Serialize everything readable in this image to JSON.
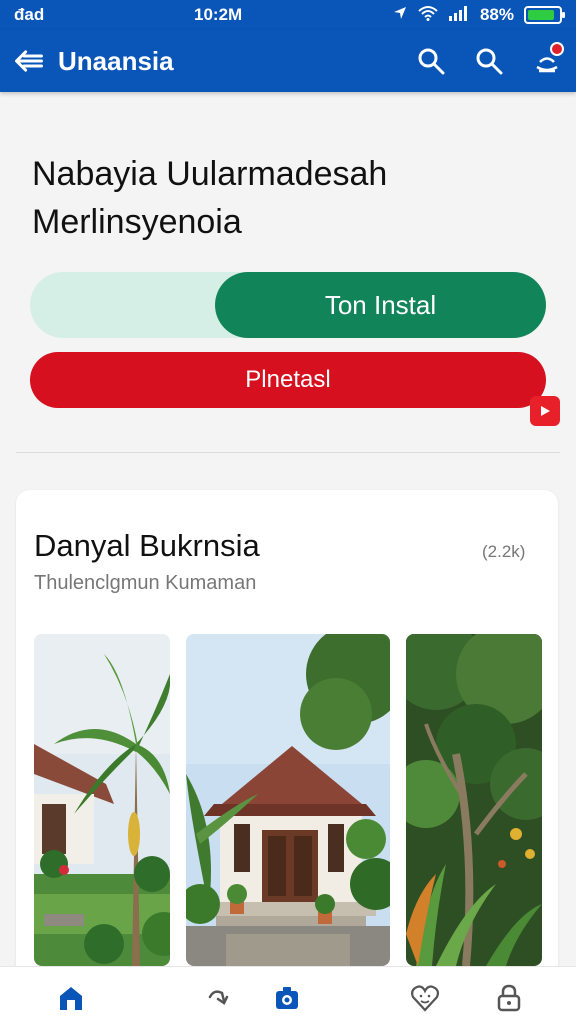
{
  "status": {
    "carrier": "đad",
    "time": "10:2M",
    "battery": "88%",
    "battery_level": 0.88
  },
  "appbar": {
    "title": "Unaansia",
    "back_icon": "back-arrow-icon",
    "actions": [
      "search-icon",
      "search-icon",
      "notification-icon"
    ]
  },
  "headline": {
    "line1": "Nabayia Uularmadesah",
    "line2": "Merlinsyenoia"
  },
  "buttons": {
    "install_label": "Ton Instal",
    "red_label": "Plnetasl"
  },
  "card": {
    "title": "Danyal Bukrnsia",
    "count": "(2.2k)",
    "subtitle": "Thulenclgmun Kumaman",
    "photos": [
      "tropical-house-photo",
      "traditional-house-photo",
      "garden-trees-photo"
    ]
  },
  "bottom_nav": [
    "home-icon",
    "share-icon",
    "camera-icon",
    "heart-icon",
    "lock-icon"
  ],
  "colors": {
    "primary": "#0a55b8",
    "install": "#12845a",
    "install_track": "#d6efe6",
    "danger": "#d6101e"
  }
}
